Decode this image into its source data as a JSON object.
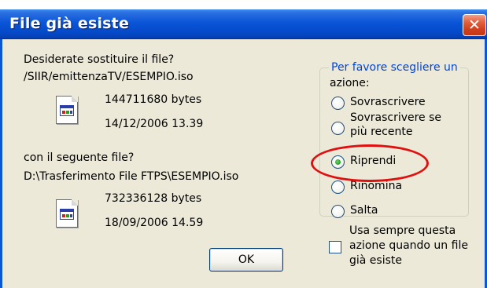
{
  "dialog": {
    "title": "File già esiste",
    "close_icon": "close-icon",
    "replace_question": "Desiderate sostituire il file?",
    "existing_path": "/SIIR/emittenzaTV/ESEMPIO.iso",
    "existing_size": "144711680 bytes",
    "existing_date": "14/12/2006 13.39",
    "with_label": "con il seguente file?",
    "new_path": "D:\\Trasferimento File FTPS\\ESEMPIO.iso",
    "new_size": "732336128 bytes",
    "new_date": "18/09/2006 14.59",
    "ok_label": "OK"
  },
  "options": {
    "title_line1": "Per favore scegliere un",
    "title_line2": "azione:",
    "overwrite": "Sovrascrivere",
    "overwrite_newer_line1": "Sovrascrivere se",
    "overwrite_newer_line2": "più recente",
    "resume": "Riprendi",
    "rename": "Rinomina",
    "skip": "Salta",
    "selected": "Riprendi"
  },
  "always_use": {
    "line1": "Usa sempre questa",
    "line2": "azione quando un file",
    "line3": "già esiste",
    "checked": false
  },
  "colors": {
    "titlebar": "#0a55d8",
    "dialog_bg": "#ece9d8",
    "group_title": "#0046d5",
    "annotation": "#e01010"
  }
}
